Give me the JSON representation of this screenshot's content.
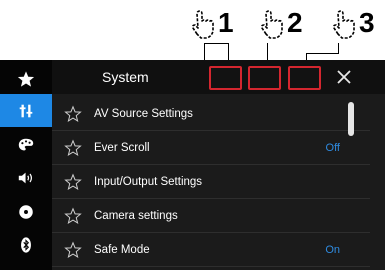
{
  "callouts": [
    "1",
    "2",
    "3"
  ],
  "app": {
    "title": "System",
    "close_icon": "close-icon"
  },
  "sidebar": {
    "items": [
      {
        "icon": "star-icon",
        "active": false
      },
      {
        "icon": "settings-tools-icon",
        "active": true
      },
      {
        "icon": "palette-icon",
        "active": false
      },
      {
        "icon": "speaker-icon",
        "active": false
      },
      {
        "icon": "disc-icon",
        "active": false
      },
      {
        "icon": "bluetooth-icon",
        "active": false
      }
    ]
  },
  "list": {
    "items": [
      {
        "label": "AV Source Settings",
        "value": ""
      },
      {
        "label": "Ever Scroll",
        "value": "Off"
      },
      {
        "label": "Input/Output Settings",
        "value": ""
      },
      {
        "label": "Camera settings",
        "value": ""
      },
      {
        "label": "Safe Mode",
        "value": "On"
      }
    ]
  },
  "colors": {
    "accent_blue": "#1e88e5",
    "value_blue": "#2f8be0",
    "highlight_red": "#d4262f",
    "background": "#1b1b1b"
  }
}
